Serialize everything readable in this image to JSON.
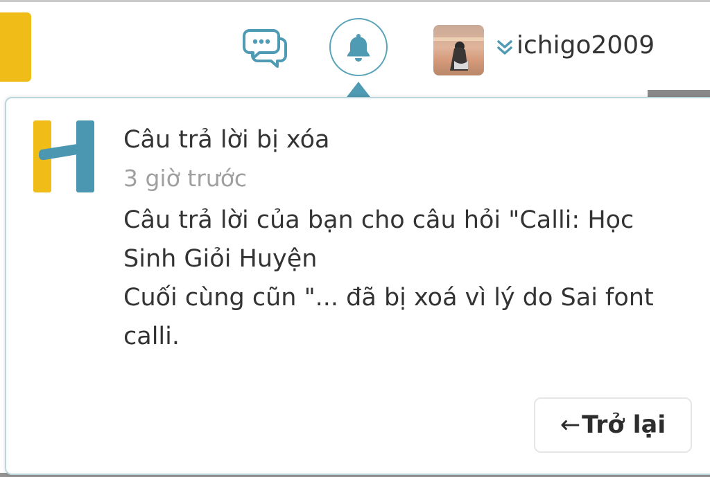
{
  "header": {
    "username": "ichigo2009",
    "icons": {
      "chat": "chat-bubbles-icon",
      "bell": "bell-icon",
      "caret": "double-chevron-down-icon"
    }
  },
  "notification": {
    "title": "Câu trả lời bị xóa",
    "time": "3 giờ trước",
    "body_lines": [
      "Câu trả lời của bạn cho câu hỏi \"Calli: Học",
      "Sinh Giỏi Huyện",
      "Cuối cùng cũn \"... đã bị xoá vì lý do Sai font",
      "calli."
    ],
    "back_label": "Trở lại",
    "back_arrow": "←"
  },
  "colors": {
    "accent_teal": "#4f9bb3",
    "logo_yellow": "#f0bd18",
    "logo_blue": "#4b96b0"
  }
}
